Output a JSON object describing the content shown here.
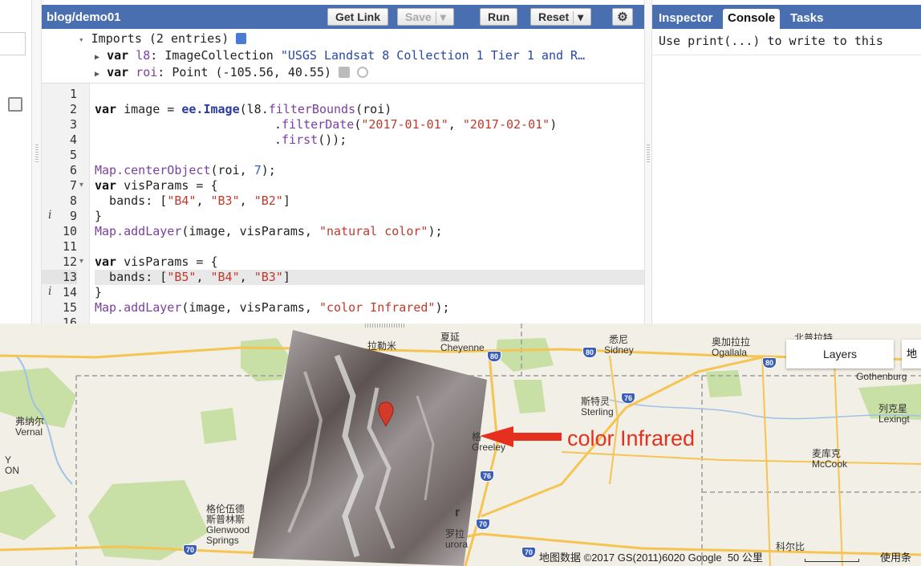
{
  "editor": {
    "script_name": "blog/demo01",
    "buttons": {
      "get_link": "Get Link",
      "save": "Save",
      "run": "Run",
      "reset": "Reset"
    },
    "imports": {
      "header": "Imports (2 entries)",
      "entries": [
        {
          "keyword": "var",
          "name": "l8",
          "type": "ImageCollection",
          "value": "\"USGS Landsat 8 Collection 1 Tier 1 and R…"
        },
        {
          "keyword": "var",
          "name": "roi",
          "type": "Point",
          "value": "(-105.56, 40.55)"
        }
      ]
    },
    "line_numbers": [
      "1",
      "2",
      "3",
      "4",
      "5",
      "6",
      "7",
      "8",
      "9",
      "10",
      "11",
      "12",
      "13",
      "14",
      "15",
      "16"
    ],
    "code": {
      "l2_a": "var",
      "l2_b": " image = ",
      "l2_c": "ee.Image",
      "l2_d": "(l8.",
      "l2_e": "filterBounds",
      "l2_f": "(roi)",
      "l3_a": ".",
      "l3_b": "filterDate",
      "l3_c": "(",
      "l3_d": "\"2017-01-01\"",
      "l3_e": ", ",
      "l3_f": "\"2017-02-01\"",
      "l3_g": ")",
      "l4_a": ".",
      "l4_b": "first",
      "l4_c": "());",
      "l6_a": "Map.",
      "l6_b": "centerObject",
      "l6_c": "(roi, ",
      "l6_d": "7",
      "l6_e": ");",
      "l7_a": "var",
      "l7_b": " visParams = {",
      "l8_a": "  bands: [",
      "l8_b": "\"B4\"",
      "l8_c": ", ",
      "l8_d": "\"B3\"",
      "l8_e": ", ",
      "l8_f": "\"B2\"",
      "l8_g": "]",
      "l9": "}",
      "l10_a": "Map.",
      "l10_b": "addLayer",
      "l10_c": "(image, visParams, ",
      "l10_d": "\"natural color\"",
      "l10_e": ");",
      "l12_a": "var",
      "l12_b": " visParams = {",
      "l13_a": "  bands: [",
      "l13_b": "\"B5\"",
      "l13_c": ", ",
      "l13_d": "\"B4\"",
      "l13_e": ", ",
      "l13_f": "\"B3\"",
      "l13_g": "]",
      "l14": "}",
      "l15_a": "Map.",
      "l15_b": "addLayer",
      "l15_c": "(image, visParams, ",
      "l15_d": "\"color Infrared\"",
      "l15_e": ");"
    }
  },
  "right_panel": {
    "tabs": [
      "Inspector",
      "Console",
      "Tasks"
    ],
    "active_tab": "Console",
    "console_text": "Use print(...) to write to this"
  },
  "map": {
    "layers_button": "Layers",
    "more_button": "地",
    "annotation": "color Infrared",
    "attribution": "地图数据 ©2017 GS(2011)6020 Google",
    "scale_label": "50 公里",
    "terms": "使用条",
    "cities": [
      {
        "zh": "夏延",
        "en": "Cheyenne"
      },
      {
        "zh": "悉尼",
        "en": "Sidney"
      },
      {
        "zh": "奥加拉拉",
        "en": "Ogallala"
      },
      {
        "zh": "北普拉特",
        "en": ""
      },
      {
        "zh": "拉勒米",
        "en": ""
      },
      {
        "zh": "斯特灵",
        "en": "Sterling"
      },
      {
        "zh": "弗纳尔",
        "en": "Vernal"
      },
      {
        "zh": "列克星",
        "en": "Lexingt"
      },
      {
        "zh": "麦库克",
        "en": "McCook"
      },
      {
        "zh": "格",
        "en": "Greeley"
      },
      {
        "zh": "格伦伍德",
        "en": "Glenwood"
      },
      {
        "zh": "斯普林斯",
        "en": "Springs"
      },
      {
        "zh": "罗拉",
        "en": "urora"
      },
      {
        "zh": "科尔比",
        "en": ""
      },
      {
        "zh": "",
        "en": "Gothenburg"
      },
      {
        "zh": "",
        "en": "ON"
      },
      {
        "zh": "",
        "en": "Y"
      },
      {
        "zh": "",
        "en": "r"
      }
    ],
    "highways": [
      "80",
      "80",
      "80",
      "76",
      "76",
      "70",
      "70",
      "70"
    ],
    "colors": {
      "park": "#c8dfa5",
      "road": "#f5c452",
      "marker": "#d23b2a",
      "arrow": "#e53020"
    }
  }
}
